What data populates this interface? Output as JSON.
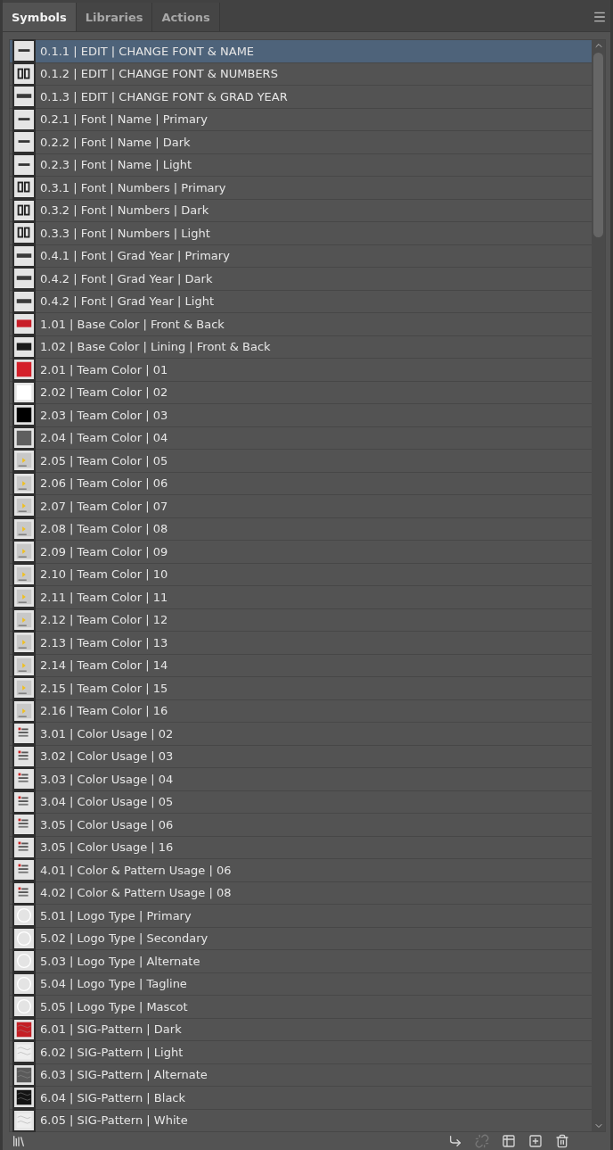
{
  "tabs": [
    {
      "label": "Symbols",
      "selected": true
    },
    {
      "label": "Libraries",
      "selected": false
    },
    {
      "label": "Actions",
      "selected": false
    }
  ],
  "symbols": [
    {
      "name": "0.1.1 | EDIT | CHANGE FONT & NAME",
      "kind": "name",
      "selected": true
    },
    {
      "name": "0.1.2 | EDIT | CHANGE FONT & NUMBERS",
      "kind": "numbers",
      "selected": false
    },
    {
      "name": "0.1.3 | EDIT | CHANGE FONT & GRAD YEAR",
      "kind": "year",
      "selected": false
    },
    {
      "name": "0.2.1 | Font | Name | Primary",
      "kind": "name",
      "selected": false
    },
    {
      "name": "0.2.2 | Font | Name | Dark",
      "kind": "name",
      "selected": false
    },
    {
      "name": "0.2.3 | Font | Name | Light",
      "kind": "name",
      "selected": false
    },
    {
      "name": "0.3.1 | Font | Numbers | Primary",
      "kind": "numbers",
      "selected": false
    },
    {
      "name": "0.3.2 | Font | Numbers | Dark",
      "kind": "numbers",
      "selected": false
    },
    {
      "name": "0.3.3 | Font | Numbers | Light",
      "kind": "numbers",
      "selected": false
    },
    {
      "name": "0.4.1 | Font | Grad Year | Primary",
      "kind": "year",
      "selected": false
    },
    {
      "name": "0.4.2 | Font | Grad Year | Dark",
      "kind": "year",
      "selected": false
    },
    {
      "name": "0.4.2 | Font | Grad Year | Light",
      "kind": "year",
      "selected": false
    },
    {
      "name": "1.01 | Base Color | Front & Back",
      "kind": "bar",
      "color": "#c81e28",
      "selected": false
    },
    {
      "name": "1.02 | Base Color | Lining | Front & Back",
      "kind": "bar",
      "color": "#1a1a1a",
      "selected": false
    },
    {
      "name": "2.01 | Team Color | 01",
      "kind": "swatch",
      "color": "#d4202a",
      "selected": false
    },
    {
      "name": "2.02 | Team Color | 02",
      "kind": "swatch",
      "color": "#ffffff",
      "selected": false
    },
    {
      "name": "2.03 | Team Color | 03",
      "kind": "swatch",
      "color": "#000000",
      "selected": false
    },
    {
      "name": "2.04 | Team Color | 04",
      "kind": "swatch",
      "color": "#5f5f5f",
      "selected": false
    },
    {
      "name": "2.05 | Team Color | 05",
      "kind": "card",
      "selected": false
    },
    {
      "name": "2.06 | Team Color | 06",
      "kind": "card",
      "selected": false
    },
    {
      "name": "2.07 | Team Color | 07",
      "kind": "card",
      "selected": false
    },
    {
      "name": "2.08 | Team Color | 08",
      "kind": "card",
      "selected": false
    },
    {
      "name": "2.09 | Team Color | 09",
      "kind": "card",
      "selected": false
    },
    {
      "name": "2.10 | Team Color | 10",
      "kind": "card",
      "selected": false
    },
    {
      "name": "2.11 | Team Color | 11",
      "kind": "card",
      "selected": false
    },
    {
      "name": "2.12 | Team Color | 12",
      "kind": "card",
      "selected": false
    },
    {
      "name": "2.13 | Team Color | 13",
      "kind": "card",
      "selected": false
    },
    {
      "name": "2.14 | Team Color | 14",
      "kind": "card",
      "selected": false
    },
    {
      "name": "2.15 | Team Color | 15",
      "kind": "card",
      "selected": false
    },
    {
      "name": "2.16 | Team Color | 16",
      "kind": "card",
      "selected": false
    },
    {
      "name": "3.01 | Color Usage | 02",
      "kind": "usage",
      "selected": false
    },
    {
      "name": "3.02 | Color Usage | 03",
      "kind": "usage",
      "selected": false
    },
    {
      "name": "3.03 | Color Usage | 04",
      "kind": "usage",
      "selected": false
    },
    {
      "name": "3.04 | Color Usage | 05",
      "kind": "usage",
      "selected": false
    },
    {
      "name": "3.05 | Color Usage | 06",
      "kind": "usage",
      "selected": false
    },
    {
      "name": "3.05 | Color Usage | 16",
      "kind": "usage",
      "selected": false
    },
    {
      "name": "4.01 | Color & Pattern Usage | 06",
      "kind": "usage",
      "selected": false
    },
    {
      "name": "4.02 | Color & Pattern Usage | 08",
      "kind": "usage",
      "selected": false
    },
    {
      "name": "5.01 | Logo Type | Primary",
      "kind": "logo",
      "selected": false
    },
    {
      "name": "5.02 | Logo Type | Secondary",
      "kind": "logo",
      "selected": false
    },
    {
      "name": "5.03 | Logo Type | Alternate",
      "kind": "logo",
      "selected": false
    },
    {
      "name": "5.04 | Logo Type | Tagline",
      "kind": "logo",
      "selected": false
    },
    {
      "name": "5.05 | Logo Type | Mascot",
      "kind": "logo",
      "selected": false
    },
    {
      "name": "6.01 | SIG-Pattern | Dark",
      "kind": "pattern",
      "color": "#c41e24",
      "selected": false
    },
    {
      "name": "6.02 | SIG-Pattern | Light",
      "kind": "pattern",
      "color": "#eeeeee",
      "selected": false
    },
    {
      "name": "6.03 | SIG-Pattern | Alternate",
      "kind": "pattern",
      "color": "#5a5a5a",
      "selected": false
    },
    {
      "name": "6.04 | SIG-Pattern | Black",
      "kind": "pattern",
      "color": "#141414",
      "selected": false
    },
    {
      "name": "6.05 | SIG-Pattern | White",
      "kind": "pattern",
      "color": "#eeeeee",
      "selected": false
    }
  ]
}
